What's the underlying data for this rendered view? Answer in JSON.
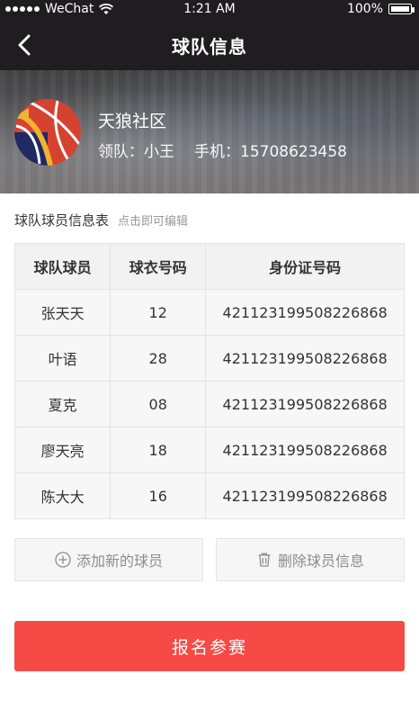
{
  "status_bar": {
    "carrier": "WeChat",
    "time": "1:21 AM",
    "battery": "100%"
  },
  "nav": {
    "title": "球队信息"
  },
  "team": {
    "name": "天狼社区",
    "leader_label": "领队：",
    "leader_name": "小王",
    "phone_label": "手机：",
    "phone": "15708623458",
    "logo_colors": {
      "navy": "#1f2a63",
      "red": "#d64230",
      "gold": "#f0b230"
    }
  },
  "roster": {
    "caption": "球队球员信息表",
    "hint": "点击即可编辑",
    "columns": [
      "球队球员",
      "球衣号码",
      "身份证号码"
    ],
    "rows": [
      {
        "name": "张天天",
        "number": "12",
        "id": "421123199508226868"
      },
      {
        "name": "叶语",
        "number": "28",
        "id": "421123199508226868"
      },
      {
        "name": "夏克",
        "number": "08",
        "id": "421123199508226868"
      },
      {
        "name": "廖天亮",
        "number": "18",
        "id": "421123199508226868"
      },
      {
        "name": "陈大大",
        "number": "16",
        "id": "421123199508226868"
      }
    ]
  },
  "actions": {
    "add_label": "添加新的球员",
    "delete_label": "删除球员信息"
  },
  "submit": {
    "label": "报名参赛",
    "color": "#f54a45"
  }
}
